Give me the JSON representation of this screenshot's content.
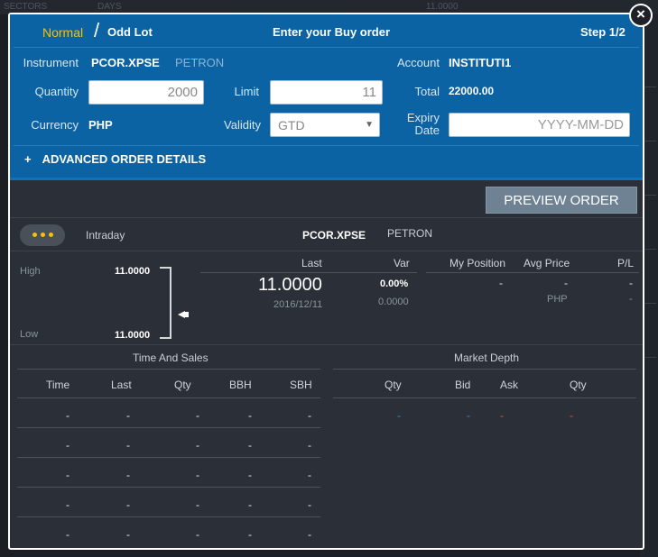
{
  "background": {
    "strip_labels": [
      "SECTORS",
      "DAYS",
      "11.0000"
    ]
  },
  "header": {
    "normal_tab": "Normal",
    "slash": "/",
    "odd_lot_tab": "Odd Lot",
    "title": "Enter your Buy order",
    "step": "Step 1/2"
  },
  "close_icon": "×",
  "form": {
    "instrument_label": "Instrument",
    "instrument_symbol": "PCOR.XPSE",
    "instrument_name": "PETRON",
    "account_label": "Account",
    "account_value": "INSTITUTI1",
    "quantity_label": "Quantity",
    "quantity_value": "2000",
    "limit_label": "Limit",
    "limit_value": "11",
    "total_label": "Total",
    "total_value": "22000.00",
    "currency_label": "Currency",
    "currency_value": "PHP",
    "validity_label": "Validity",
    "validity_value": "GTD",
    "validity_arrow": "▼",
    "expiry_label_1": "Expiry",
    "expiry_label_2": "Date",
    "expiry_placeholder": "YYYY-MM-DD",
    "advanced_plus": "+",
    "advanced_label": "ADVANCED ORDER DETAILS"
  },
  "preview_button": "PREVIEW ORDER",
  "quote": {
    "intraday_label": "Intraday",
    "symbol": "PCOR.XPSE",
    "name": "PETRON",
    "high_label": "High",
    "high_value": "11.0000",
    "low_label": "Low",
    "low_value": "11.0000",
    "last_label": "Last",
    "last_value": "11.0000",
    "last_date": "2016/12/11",
    "var_label": "Var",
    "var_pct": "0.00%",
    "var_abs": "0.0000",
    "my_position_label": "My Position",
    "my_position_value": "-",
    "avg_price_label": "Avg Price",
    "avg_price_value": "-",
    "avg_price_currency": "PHP",
    "pl_label": "P/L",
    "pl_value": "-",
    "pl_value2": "-"
  },
  "time_and_sales": {
    "title": "Time And Sales",
    "columns": [
      "Time",
      "Last",
      "Qty",
      "BBH",
      "SBH"
    ],
    "rows": [
      [
        "-",
        "-",
        "-",
        "-",
        "-"
      ],
      [
        "-",
        "-",
        "-",
        "-",
        "-"
      ],
      [
        "-",
        "-",
        "-",
        "-",
        "-"
      ],
      [
        "-",
        "-",
        "-",
        "-",
        "-"
      ],
      [
        "-",
        "-",
        "-",
        "-",
        "-"
      ]
    ]
  },
  "market_depth": {
    "title": "Market Depth",
    "columns": [
      "Qty",
      "Bid",
      "Ask",
      "Qty"
    ],
    "row": [
      "-",
      "-",
      "-",
      "-"
    ],
    "bid_color": "#3a8fd6",
    "ask_color": "#e05a3a"
  }
}
